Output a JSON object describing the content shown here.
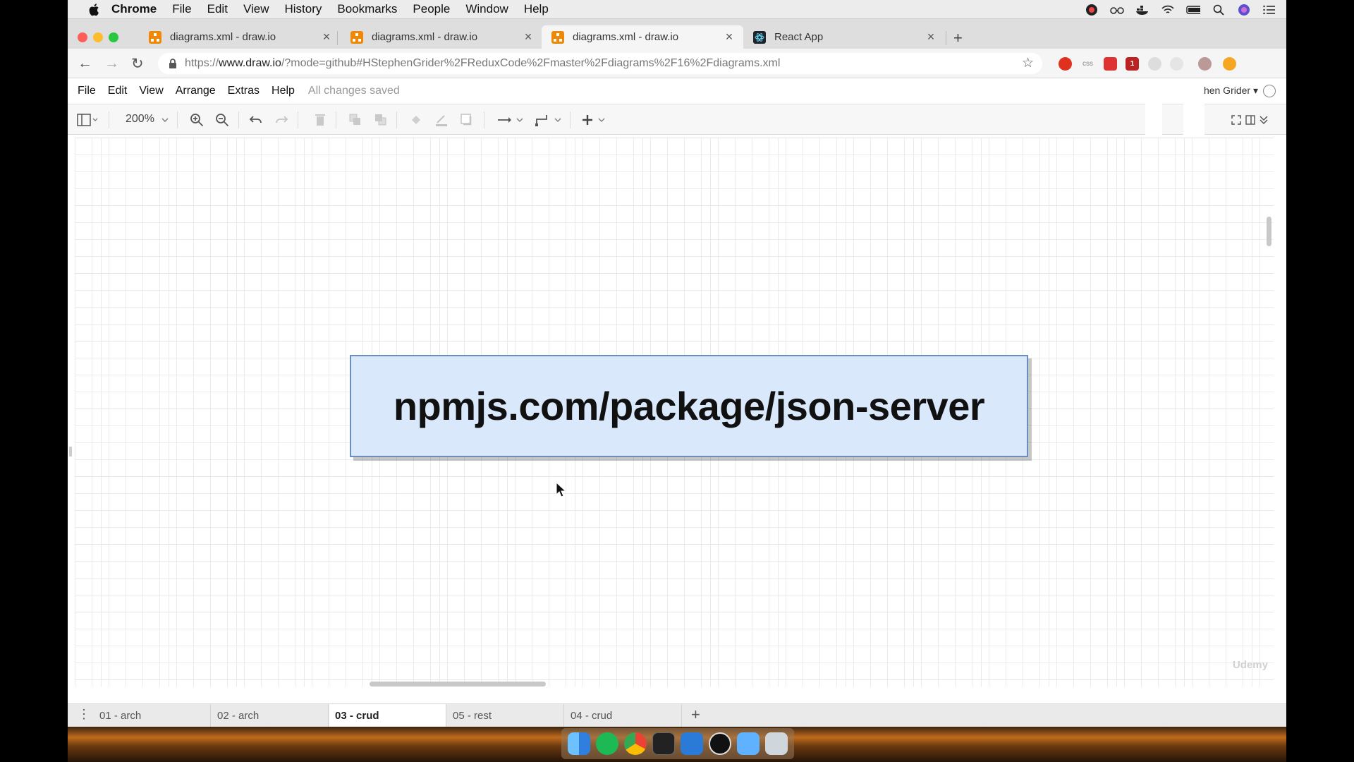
{
  "menubar": {
    "items": [
      "Chrome",
      "File",
      "Edit",
      "View",
      "History",
      "Bookmarks",
      "People",
      "Window",
      "Help"
    ]
  },
  "tabs": [
    {
      "title": "diagrams.xml - draw.io",
      "close": "×"
    },
    {
      "title": "diagrams.xml - draw.io",
      "close": "×"
    },
    {
      "title": "diagrams.xml - draw.io",
      "close": "×"
    },
    {
      "title": "React App",
      "close": "×"
    }
  ],
  "new_tab": "+",
  "address": {
    "url_prefix": "https://",
    "url_host": "www.draw.io",
    "url_rest": "/?mode=github#HStephenGrider%2FReduxCode%2Fmaster%2Fdiagrams%2F16%2Fdiagrams.xml",
    "back": "←",
    "forward": "→",
    "reload": "↻",
    "star": "☆"
  },
  "extensions": {
    "css_label": "css",
    "badge": "1"
  },
  "drawio": {
    "menu": [
      "File",
      "Edit",
      "View",
      "Arrange",
      "Extras",
      "Help"
    ],
    "status": "All changes saved",
    "user": "hen Grider ▾",
    "zoom": "200%",
    "shape_text": "npmjs.com/package/json-server",
    "watermark": "Udemy",
    "pages": [
      "01 - arch",
      "02 - arch",
      "03 - crud",
      "05 - rest",
      "04 - crud"
    ],
    "active_page": "03 - crud",
    "add_page": "+",
    "page_menu": "⋮"
  },
  "colors": {
    "shape_fill": "#dae8fc",
    "shape_stroke": "#6c8ebf",
    "drawio_orange": "#f08705"
  }
}
